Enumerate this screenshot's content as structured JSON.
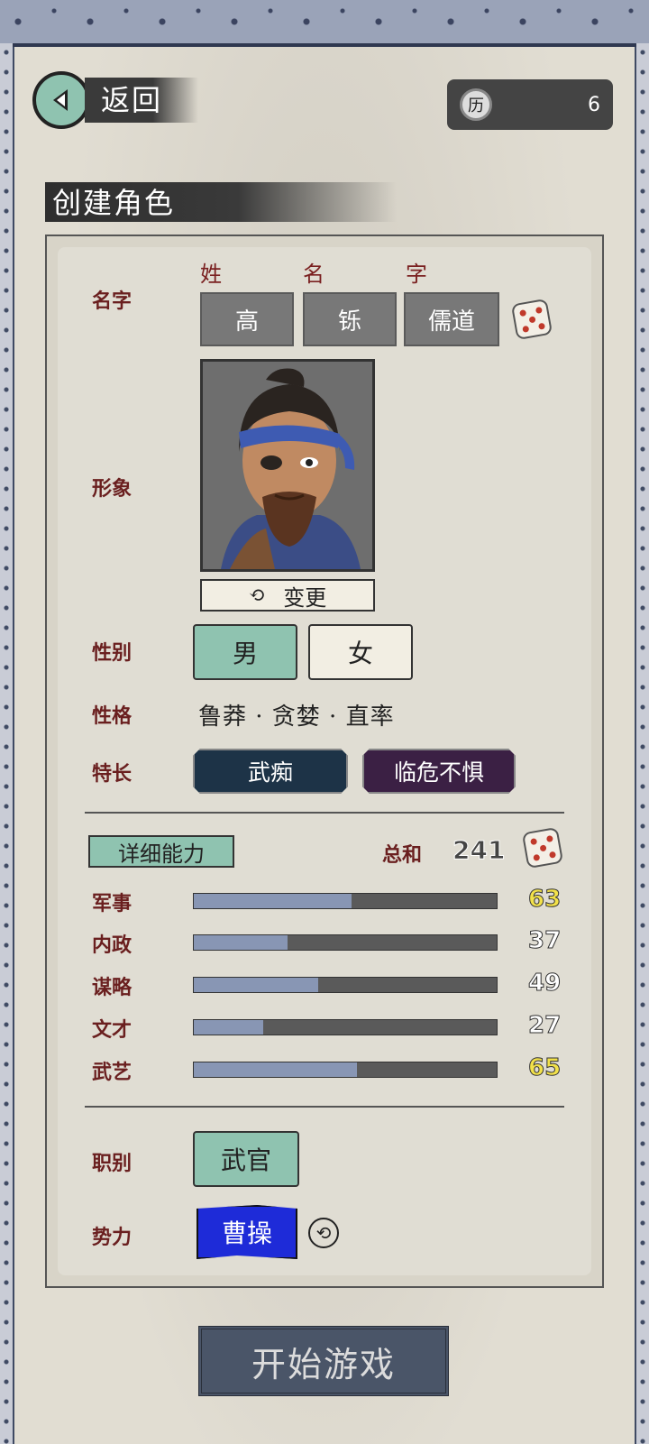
{
  "header": {
    "back_label": "返回",
    "currency_icon": "历",
    "currency_value": "6",
    "title": "创建角色"
  },
  "form": {
    "name_label": "名字",
    "name_heads": [
      "姓",
      "名",
      "字"
    ],
    "surname": "高",
    "given_name": "铄",
    "courtesy_name": "儒道",
    "portrait_label": "形象",
    "change_label": "变更",
    "gender_label": "性别",
    "gender_male": "男",
    "gender_female": "女",
    "gender_selected": "男",
    "personality_label": "性格",
    "personality_text": "鲁莽 · 贪婪 · 直率",
    "specialty_label": "特长",
    "specialties": [
      "武痴",
      "临危不惧"
    ],
    "detail_tab": "详细能力",
    "total_label": "总和",
    "total_value": "241",
    "stats": [
      {
        "label": "军事",
        "value": "63",
        "fraction": 0.52,
        "color": "#f2e14a"
      },
      {
        "label": "内政",
        "value": "37",
        "fraction": 0.31,
        "color": "#ffffff"
      },
      {
        "label": "谋略",
        "value": "49",
        "fraction": 0.41,
        "color": "#ffffff"
      },
      {
        "label": "文才",
        "value": "27",
        "fraction": 0.23,
        "color": "#ffffff"
      },
      {
        "label": "武艺",
        "value": "65",
        "fraction": 0.54,
        "color": "#f2e14a"
      }
    ],
    "role_label": "职别",
    "role_value": "武官",
    "faction_label": "势力",
    "faction_value": "曹操"
  },
  "start_button": "开始游戏",
  "colors": {
    "accent_green": "#8fc3b0",
    "specialty_1": "#1d3347",
    "specialty_2": "#3b2044",
    "faction_blue": "#1e2bd8"
  }
}
